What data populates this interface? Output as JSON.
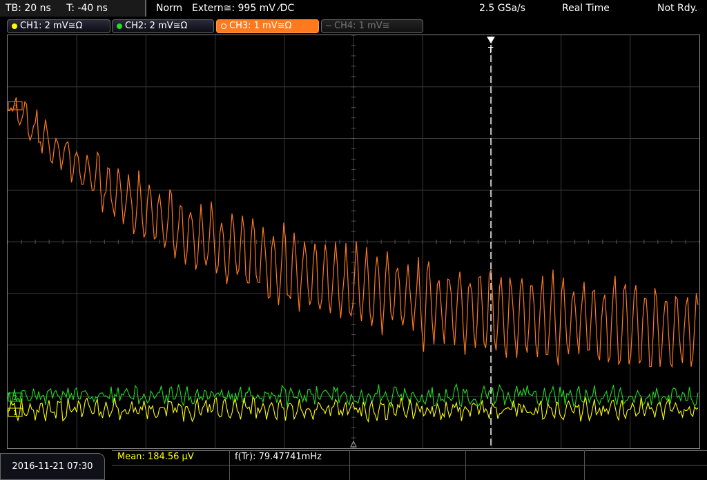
{
  "header": {
    "timebase": "TB: 20 ns",
    "trigger_time": "T: -40 ns",
    "mode": "Norm",
    "trigger_source": "Extern≅: 995 mV ⁄DC",
    "sample_rate": "2.5 GSa/s",
    "acquisition": "Real Time",
    "state": "Not Rdy."
  },
  "channels": [
    {
      "label": "CH1: 2 mV≅Ω",
      "color": "#ffff00",
      "state": "on"
    },
    {
      "label": "CH2: 2 mV≅Ω",
      "color": "#22dd22",
      "state": "on"
    },
    {
      "label": "CH3: 1 mV≅Ω",
      "color": "#ff7a1f",
      "state": "active"
    },
    {
      "label": "CH4: 1 mV≅",
      "color": "#777777",
      "state": "off"
    }
  ],
  "marker_labels": {
    "trigger": "T",
    "ch3": "3",
    "ch2": "2",
    "ch1": "1"
  },
  "footer": {
    "datetime": "2016-11-21 07:30",
    "mean_label": "Mean: 184.56 µV",
    "freq_label": "f(Tr): 79.47741mHz"
  },
  "colors": {
    "grid": "#3a3a3a",
    "ch1": "#ffff00",
    "ch2": "#22dd22",
    "ch3": "#ff7a1f",
    "mean_text": "#ffff00"
  }
}
